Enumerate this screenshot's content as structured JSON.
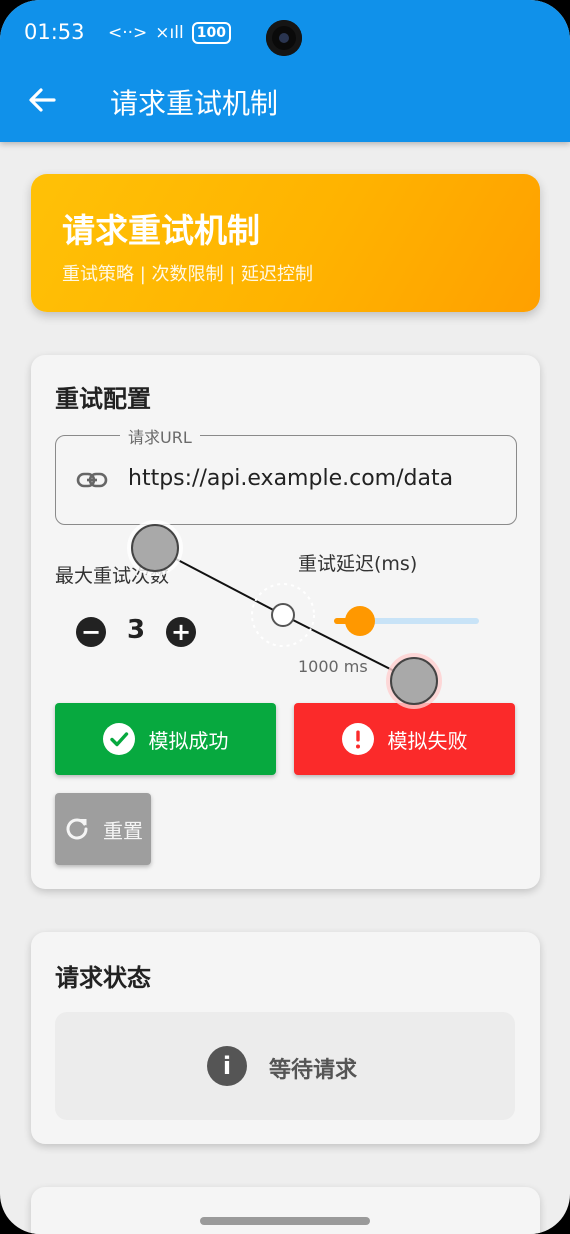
{
  "status_bar": {
    "time": "01:53",
    "data_icon": "<··>",
    "signal": "×ıll",
    "battery": "100"
  },
  "app_bar": {
    "title": "请求重试机制"
  },
  "banner": {
    "title": "请求重试机制",
    "subtitle": "重试策略 | 次数限制 | 延迟控制"
  },
  "config": {
    "title": "重试配置",
    "url_label": "请求URL",
    "url_value": "https://api.example.com/data",
    "max_retries_label": "最大重试次数",
    "max_retries_value": "3",
    "minus": "−",
    "plus": "+",
    "delay_label": "重试延迟(ms)",
    "delay_value_text": "1000 ms",
    "delay_fraction": 0.18,
    "success_button": "模拟成功",
    "fail_button": "模拟失败",
    "reset_button": "重置"
  },
  "status": {
    "title": "请求状态",
    "icon": "i",
    "text": "等待请求"
  },
  "colors": {
    "app_bar": "#1091ea",
    "banner": "#ffb300",
    "success": "#07a93f",
    "fail": "#fb2a2a",
    "reset": "#9e9e9e",
    "slider": "#ff9800"
  }
}
